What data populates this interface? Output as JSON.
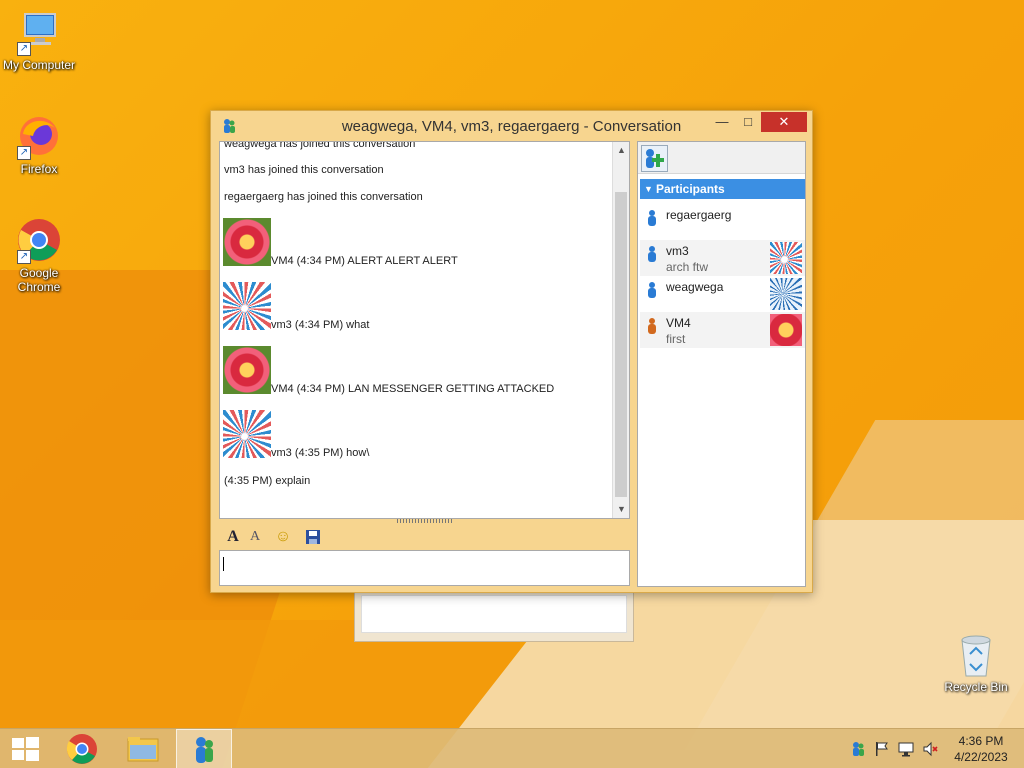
{
  "desktop": {
    "icons": [
      {
        "label": "My Computer"
      },
      {
        "label": "Firefox"
      },
      {
        "label": "Google Chrome"
      }
    ],
    "recycle_bin": "Recycle Bin"
  },
  "window": {
    "title": "weagwega, VM4, vm3, regaergaerg - Conversation",
    "min_label": "—",
    "max_label": "□",
    "close_label": "✕"
  },
  "chat": {
    "system_messages": [
      "weagwega has joined this conversation",
      "vm3 has joined this conversation",
      "regaergaerg has joined this conversation"
    ],
    "messages": [
      {
        "avatar": "flower",
        "text": "VM4 (4:34 PM) ALERT ALERT ALERT"
      },
      {
        "avatar": "ferris-wheel",
        "text": "vm3 (4:34 PM) what"
      },
      {
        "avatar": "flower",
        "text": "VM4 (4:34 PM) LAN MESSENGER GETTING ATTACKED"
      },
      {
        "avatar": "ferris-wheel",
        "text": "vm3 (4:35 PM) how\\"
      }
    ],
    "own_message": "(4:35 PM) explain",
    "input_value": ""
  },
  "toolbar": {
    "font_icon": "A",
    "font_color_icon": "A",
    "emoji_icon": "☺",
    "save_icon": "save-icon"
  },
  "participants": {
    "header": "Participants",
    "list": [
      {
        "name": "regaergaerg",
        "status": "",
        "avatar": ""
      },
      {
        "name": "vm3",
        "status": "arch ftw",
        "avatar": "ferris-wheel"
      },
      {
        "name": "weagwega",
        "status": "",
        "avatar": "ferris-wheel-2"
      },
      {
        "name": "VM4",
        "status": "first",
        "avatar": "flower"
      }
    ]
  },
  "taskbar": {
    "clock_time": "4:36 PM",
    "clock_date": "4/22/2023"
  },
  "colors": {
    "accent": "#3b8fe3",
    "close_button": "#c7312a",
    "window_frame": "#f7d58f"
  }
}
